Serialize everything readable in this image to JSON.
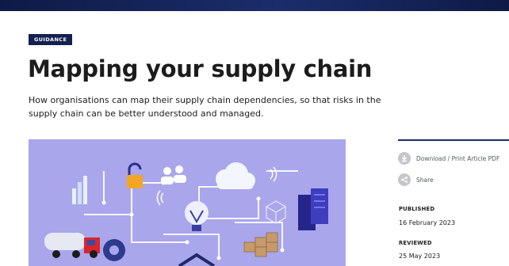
{
  "page": {
    "tag": "GUIDANCE",
    "title": "Mapping your supply chain",
    "summary": "How organisations can map their supply chain dependencies, so that risks in the supply chain can be better understood and managed."
  },
  "hero_image": {
    "background": "#a9a6ec",
    "icons": [
      "bar-chart-icon",
      "padlock-icon",
      "people-icon",
      "cloud-icon",
      "wifi-icon",
      "lightbulb-icon",
      "server-rack-icon",
      "cube-icon",
      "boxes-icon",
      "gear-icon",
      "tanker-truck-icon"
    ]
  },
  "sidebar": {
    "actions": [
      {
        "label": "Download / Print Article PDF",
        "icon": "download-icon"
      },
      {
        "label": "Share",
        "icon": "share-icon"
      }
    ],
    "published_label": "PUBLISHED",
    "published_value": "16 February 2023",
    "reviewed_label": "REVIEWED",
    "reviewed_value": "25 May 2023"
  },
  "colors": {
    "header_bar": "#14204f",
    "tag_background": "#14204f",
    "hero_background": "#a9a6ec",
    "text": "#1c1c1c"
  }
}
